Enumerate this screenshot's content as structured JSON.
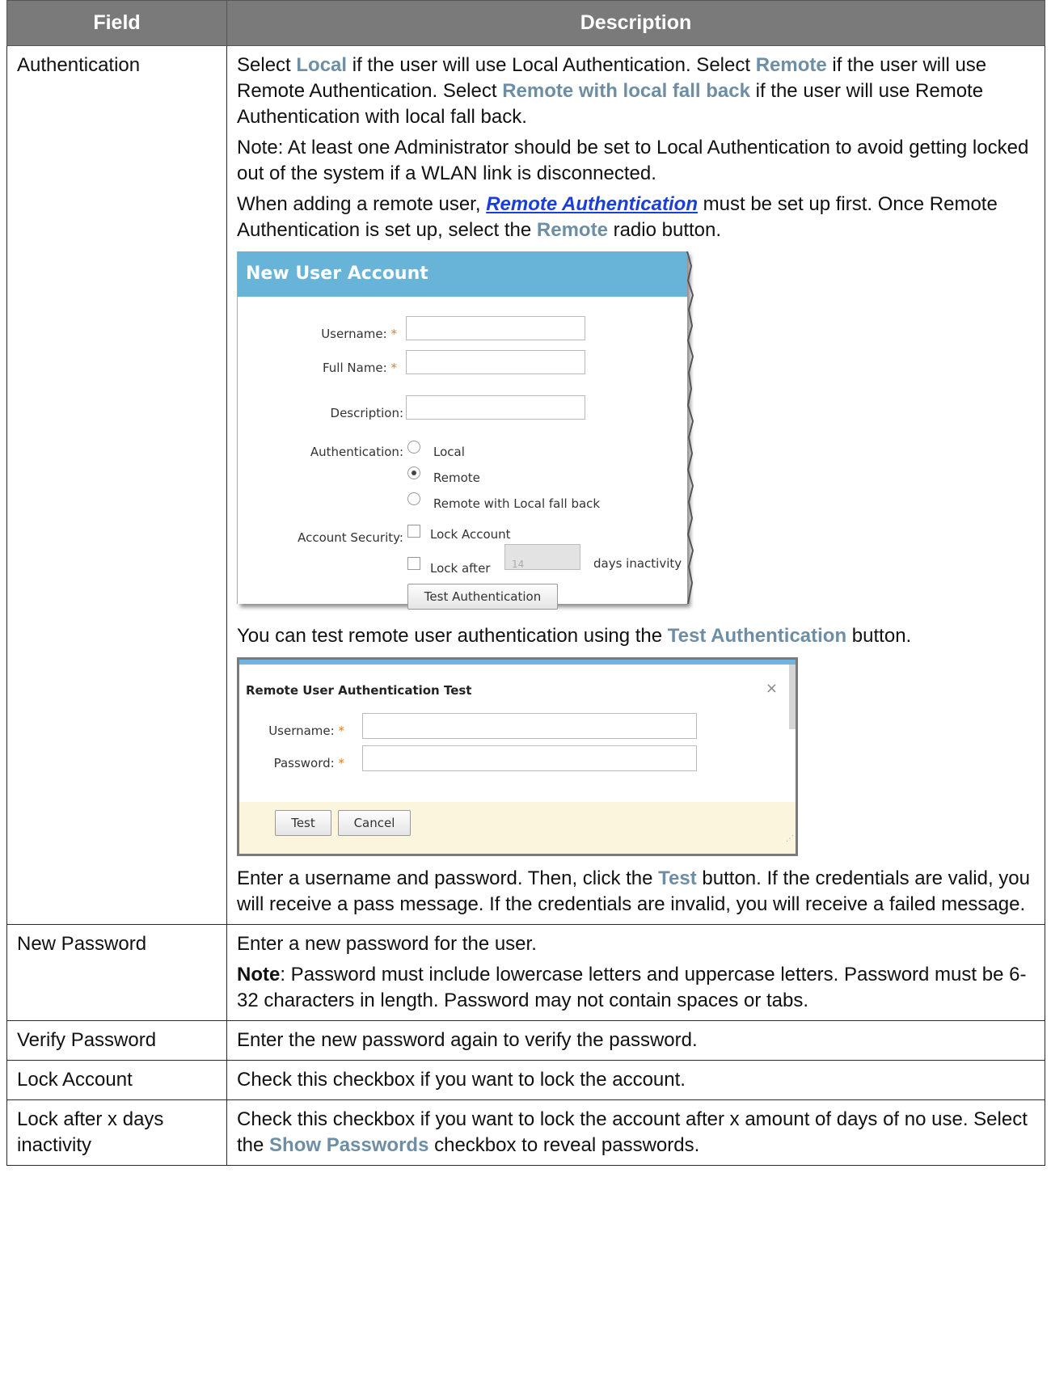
{
  "table": {
    "headers": [
      "Field",
      "Description"
    ],
    "rows": {
      "authentication": {
        "field": "Authentication",
        "p1": {
          "t1": "Select ",
          "h1": "Local",
          "t2": " if the user will use Local Authentication. Select ",
          "h2": "Remote",
          "t3": " if the user will use Remote Authentication. Select ",
          "h3": "Remote with local fall back",
          "t4": " if the user will use Remote Authentication with local fall back."
        },
        "p2": "Note: At least one Administrator should be set to Local Authentication to avoid getting locked out of the system if a WLAN link is disconnected.",
        "p3": {
          "t1": "When adding a remote user, ",
          "link": "Remote Authentication",
          "t2": " must be set up first. Once Remote Authentication is set up, select the ",
          "h1": "Remote",
          "t3": " radio button."
        },
        "p4": {
          "t1": "You can test remote user authentication using the ",
          "h1": "Test Authentication",
          "t2": " button."
        },
        "p5": {
          "t1": "Enter a username and password. Then, click the ",
          "h1": "Test",
          "t2": " button. If the credentials are valid, you will receive a pass message. If the credentials are invalid, you will receive a failed message."
        }
      },
      "new_password": {
        "field": "New Password",
        "p1": "Enter a new password for the user.",
        "note_label": "Note",
        "note_text": ": Password must include lowercase letters and uppercase letters. Password must be 6-32 characters in length. Password may not contain spaces or tabs."
      },
      "verify_password": {
        "field": "Verify Password",
        "desc": "Enter the new password again to verify the password."
      },
      "lock_account": {
        "field": "Lock Account",
        "desc": "Check this checkbox if you want to lock the account."
      },
      "lock_after": {
        "field": "Lock after x days inactivity",
        "t1": "Check this checkbox if you want to lock the account after x amount of days of no use. Select the ",
        "h1": "Show Passwords",
        "t2": " checkbox to reveal passwords."
      }
    }
  },
  "new_user_account": {
    "title": "New User Account",
    "username_label": "Username:",
    "fullname_label": "Full Name:",
    "description_label": "Description:",
    "authentication_label": "Authentication:",
    "auth_options": [
      "Local",
      "Remote",
      "Remote with Local fall back"
    ],
    "auth_selected": "Remote",
    "account_security_label": "Account Security:",
    "lock_account_label": "Lock Account",
    "lock_after_label": "Lock after",
    "lock_after_value": "14",
    "days_inactivity_label": "days inactivity",
    "test_button": "Test Authentication",
    "required_mark": "*"
  },
  "remote_test_dialog": {
    "title": "Remote User Authentication Test",
    "close_glyph": "×",
    "username_label": "Username:",
    "password_label": "Password:",
    "required_mark": "*",
    "test_button": "Test",
    "cancel_button": "Cancel"
  },
  "colors": {
    "header_bg": "#7a7a7a",
    "highlight": "#6d8ea5",
    "link": "#1a3fd6",
    "dialog_accent": "#67b4d8",
    "required": "#ef7a1f"
  }
}
